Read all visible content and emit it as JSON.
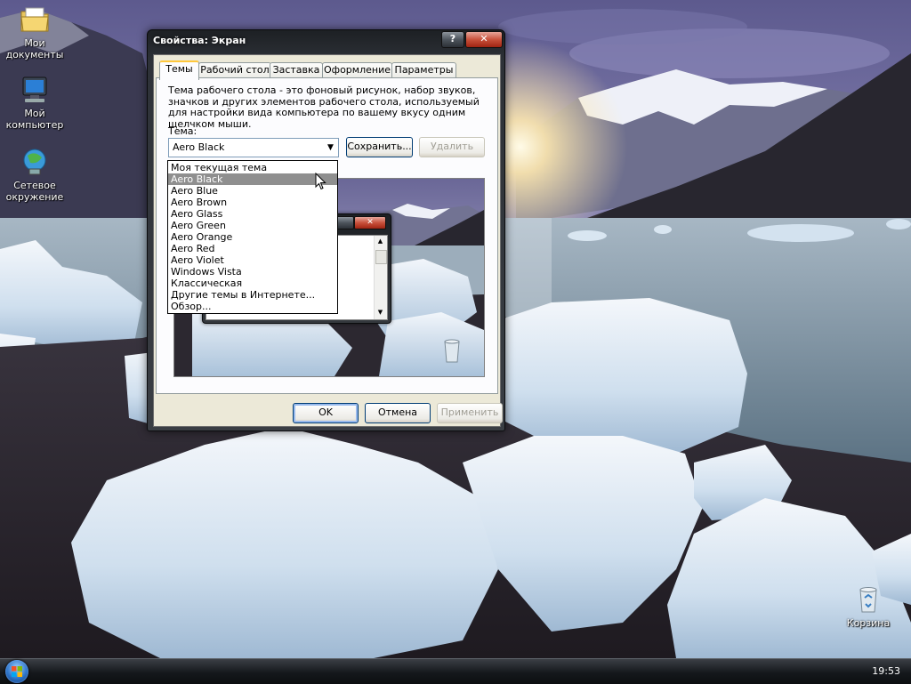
{
  "desktop": {
    "icons": [
      {
        "label": "Мои документы",
        "icon": "my-documents-icon"
      },
      {
        "label": "Мой компьютер",
        "icon": "my-computer-icon"
      },
      {
        "label": "Сетевое окружение",
        "icon": "network-icon"
      },
      {
        "label": "Корзина",
        "icon": "recycle-bin-icon"
      }
    ]
  },
  "taskbar": {
    "clock": "19:53"
  },
  "window": {
    "title": "Свойства: Экран",
    "help_label": "?",
    "close_label": "✕",
    "tabs": [
      {
        "label": "Темы"
      },
      {
        "label": "Рабочий стол"
      },
      {
        "label": "Заставка"
      },
      {
        "label": "Оформление"
      },
      {
        "label": "Параметры"
      }
    ],
    "description": "Тема рабочего стола - это фоновый рисунок, набор звуков, значков и других элементов рабочего стола, используемый для настройки вида компьютера по вашему вкусу одним щелчком мыши.",
    "theme_label": "Тема:",
    "theme_value": "Aero Black",
    "save_label": "Сохранить...",
    "delete_label": "Удалить",
    "dropdown_items": [
      "Моя текущая тема",
      "Aero Black",
      "Aero Blue",
      "Aero Brown",
      "Aero Glass",
      "Aero Green",
      "Aero Orange",
      "Aero Red",
      "Aero Violet",
      "Windows Vista",
      "Классическая",
      "Другие темы в Интернете...",
      "Обзор..."
    ],
    "selected_index": 1,
    "ok_label": "OK",
    "cancel_label": "Отмена",
    "apply_label": "Применить"
  }
}
